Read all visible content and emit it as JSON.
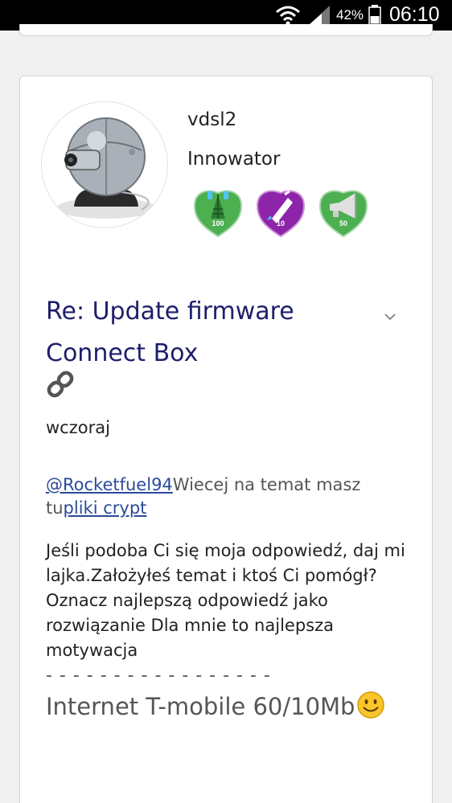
{
  "status_bar": {
    "battery_percent": "42%",
    "time": "06:10"
  },
  "post": {
    "username": "vdsl2",
    "rank": "Innowator",
    "badges": [
      {
        "icon": "antenna-badge-icon",
        "value": "100",
        "color": "#4caf50"
      },
      {
        "icon": "rocket-badge-icon",
        "value": "10",
        "color": "#8e24aa"
      },
      {
        "icon": "megaphone-badge-icon",
        "value": "50",
        "color": "#4caf50"
      }
    ],
    "title": "Re: Update firmware Connect Box",
    "date": "wczoraj",
    "mention_link": "@Rocketfuel94",
    "mention_text": "Wiecej na temat masz tu",
    "crypt_link": "pliki crypt",
    "body": "Jeśli podoba Ci się moja odpowiedź, daj mi lajka.Założyłeś temat i ktoś Ci pomógł? Oznacz najlepszą odpowiedź jako rozwiązanie Dla mnie to najlepsza motywacja",
    "dashes": "- - - - - - - - - - - - - - - - -",
    "signature": "Internet T-mobile 60/10Mb"
  },
  "colors": {
    "title": "#1e1f6b",
    "link": "#2a4a9a",
    "background": "#f0f0f0"
  }
}
